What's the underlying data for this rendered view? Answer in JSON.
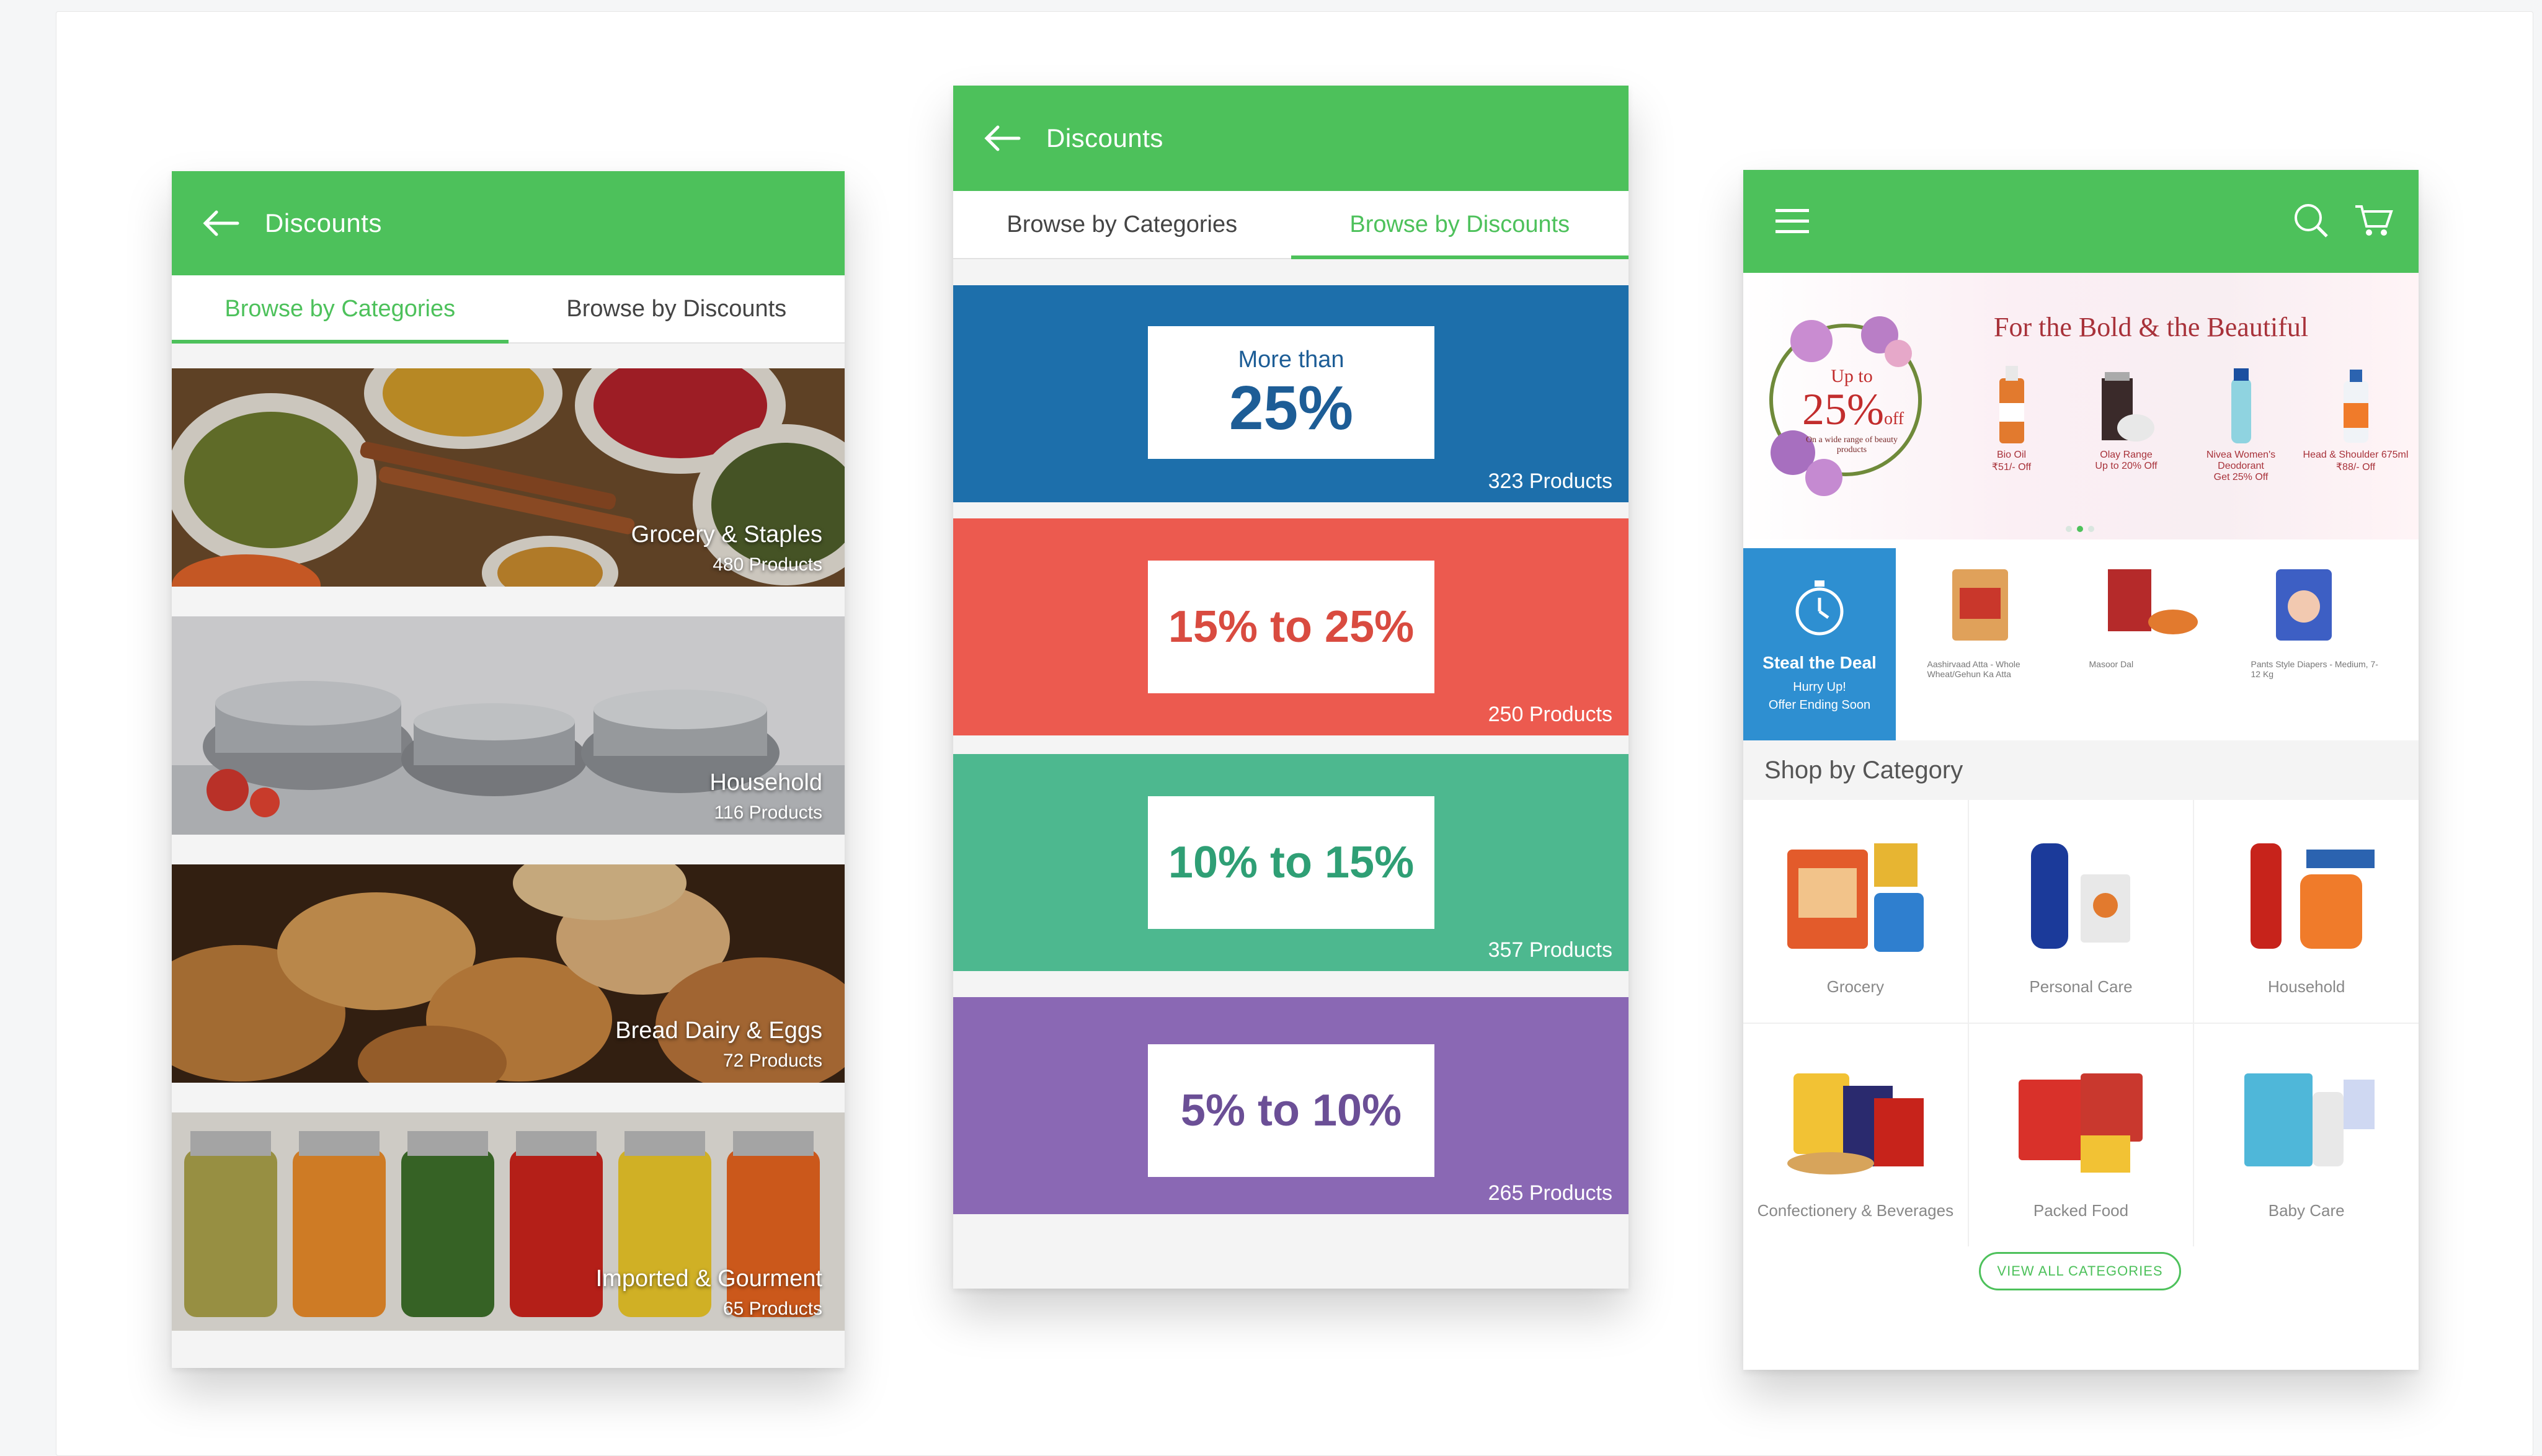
{
  "colors": {
    "green": "#4dc15b",
    "blue": "#1d6fab",
    "red": "#ec5a4f",
    "teal": "#4db88f",
    "purple": "#8a68b4",
    "dealBlue": "#2e8fd1"
  },
  "screen1": {
    "title": "Discounts",
    "tabs": [
      {
        "label": "Browse by Categories",
        "active": true
      },
      {
        "label": "Browse by Discounts",
        "active": false
      }
    ],
    "categories": [
      {
        "name": "Grocery & Staples",
        "count": "480 Products"
      },
      {
        "name": "Household",
        "count": "116  Products"
      },
      {
        "name": "Bread Dairy & Eggs",
        "count": "72 Products"
      },
      {
        "name": "Imported & Gourment",
        "count": "65 Products"
      }
    ]
  },
  "screen2": {
    "title": "Discounts",
    "tabs": [
      {
        "label": "Browse by Categories",
        "active": false
      },
      {
        "label": "Browse by Discounts",
        "active": true
      }
    ],
    "discounts": [
      {
        "prefix": "More than",
        "value": "25%",
        "count": "323 Products"
      },
      {
        "prefix": "",
        "value": "15% to 25%",
        "count": "250 Products"
      },
      {
        "prefix": "",
        "value": "10% to 15%",
        "count": "357 Products"
      },
      {
        "prefix": "",
        "value": "5% to 10%",
        "count": "265 Products"
      }
    ]
  },
  "screen3": {
    "icons": {
      "menu": "menu-icon",
      "search": "search-icon",
      "cart": "cart-icon"
    },
    "banner": {
      "headline": "For the Bold & the Beautiful",
      "upto": "Up to",
      "pct": "25%",
      "off": "off",
      "sub": "On a wide range of beauty products",
      "products": [
        {
          "name": "Bio Oil",
          "offer": "₹51/- Off"
        },
        {
          "name": "Olay Range",
          "offer": "Up to 20% Off"
        },
        {
          "name": "Nivea Women's Deodorant",
          "offer": "Get 25% Off"
        },
        {
          "name": "Head & Shoulder 675ml",
          "offer": "₹88/- Off"
        }
      ]
    },
    "deal": {
      "title": "Steal the Deal",
      "line1": "Hurry Up!",
      "line2": "Offer Ending Soon",
      "items": [
        "Aashirvaad Atta - Whole Wheat/Gehun Ka Atta",
        "Masoor Dal",
        "Pants Style Diapers - Medium, 7-12 Kg"
      ]
    },
    "section": "Shop by Category",
    "categories": [
      "Grocery",
      "Personal Care",
      "Household",
      "Confectionery & Beverages",
      "Packed Food",
      "Baby Care"
    ],
    "button": "VIEW ALL CATEGORIES"
  }
}
